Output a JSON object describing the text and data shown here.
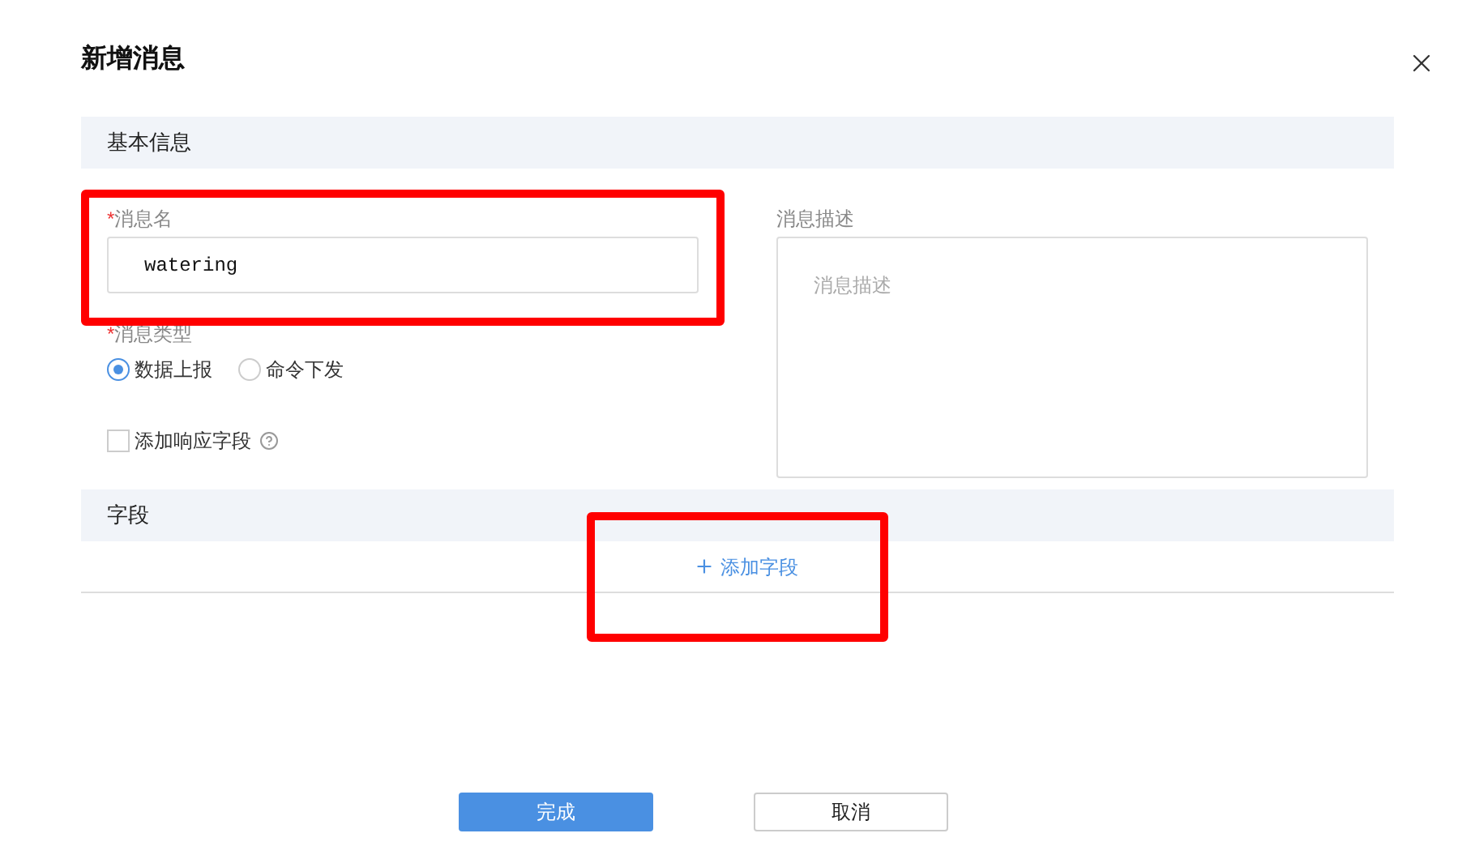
{
  "dialog": {
    "title": "新增消息"
  },
  "basic_section": {
    "title": "基本信息"
  },
  "message_name": {
    "required_mark": "*",
    "label": "消息名",
    "value": "watering"
  },
  "message_type": {
    "required_mark": "*",
    "label": "消息类型",
    "options": [
      {
        "label": "数据上报",
        "selected": true
      },
      {
        "label": "命令下发",
        "selected": false
      }
    ]
  },
  "response_field": {
    "label": "添加响应字段",
    "checked": false
  },
  "description": {
    "label": "消息描述",
    "placeholder": "消息描述"
  },
  "fields_section": {
    "title": "字段",
    "add_label": "添加字段"
  },
  "buttons": [
    {
      "label": "完成",
      "kind": "primary"
    },
    {
      "label": "取消",
      "kind": "secondary"
    }
  ]
}
